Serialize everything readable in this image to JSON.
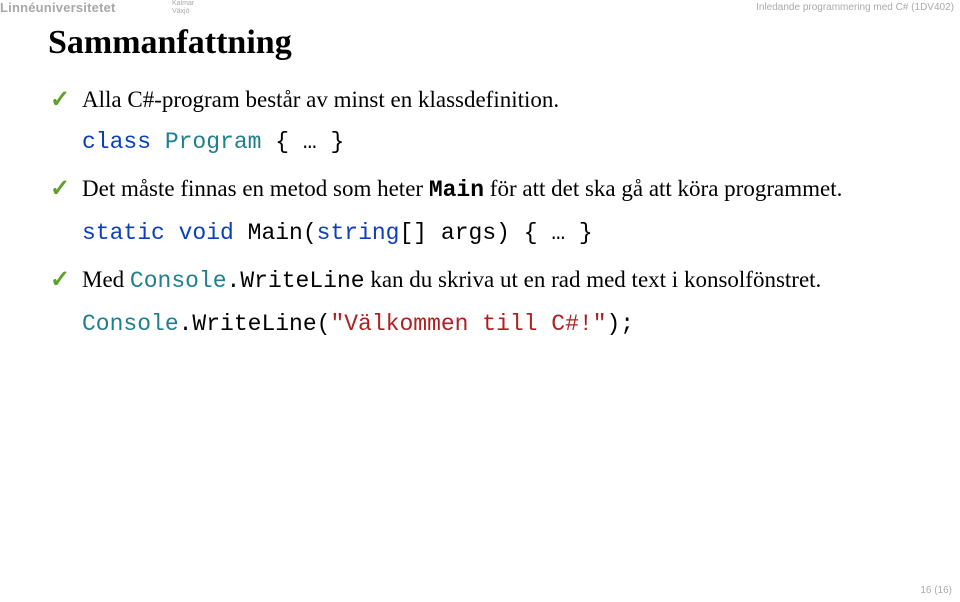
{
  "header": {
    "logo_main": "Linnéuniversitetet",
    "logo_sub_line1": "Kalmar",
    "logo_sub_line2": "Växjö",
    "course": "Inledande programmering med C# (1DV402)"
  },
  "title": "Sammanfattning",
  "bullets": {
    "b1": "Alla C#-program består av minst en klassdefinition.",
    "code1": {
      "kw_class": "class",
      "type_program": "Program",
      "rest": " { … }"
    },
    "b2_pre": "Det måste finnas en metod som heter ",
    "b2_main": "Main",
    "b2_post": " för att det ska gå att köra programmet.",
    "code2": {
      "kw_static": "static",
      "kw_void": " void",
      "rest_a": " Main(",
      "kw_string": "string",
      "rest_b": "[] args) { … }"
    },
    "b3_pre": "Med ",
    "b3_console": "Console",
    "b3_method": ".WriteLine",
    "b3_post": " kan du skriva ut en rad med text i konsolfönstret.",
    "code3": {
      "type_console": "Console",
      "mid": ".WriteLine(",
      "str": "\"Välkommen till C#!\"",
      "tail": ");"
    }
  },
  "footer": {
    "page": "16 (16)"
  }
}
